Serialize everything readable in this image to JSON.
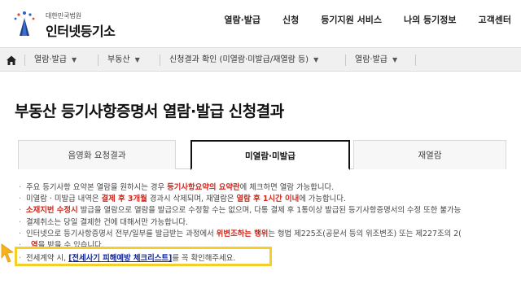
{
  "header": {
    "logo_sub": "대한민국법원",
    "logo_main": "인터넷등기소",
    "nav": [
      "열람·발급",
      "신청",
      "등기지원 서비스",
      "나의 등기정보",
      "고객센터"
    ]
  },
  "breadcrumb": {
    "items": [
      "열람·발급",
      "부동산",
      "신청결과 확인 (미열람·미발급/재열람 등)",
      "열람·발급"
    ]
  },
  "page": {
    "title": "부동산 등기사항증명서 열람·발급 신청결과"
  },
  "tabs": [
    {
      "label": "음영화 요청결과",
      "active": false
    },
    {
      "label": "미열람·미발급",
      "active": true
    },
    {
      "label": "재열람",
      "active": false
    }
  ],
  "notes": {
    "n1_a": "주요 등기사항 요약본 열람을 원하시는 경우 ",
    "n1_b": "등기사항요약의 요약란",
    "n1_c": "에 체크하면 열람 가능합니다.",
    "n2_a": "미열람 · 미발급 내역은 ",
    "n2_b": "결제 후 3개월",
    "n2_c": " 경과시 삭제되며, 재열람은 ",
    "n2_d": "열람 후 1시간 이내",
    "n2_e": "에 가능합니다.",
    "n3_a": "소재지번 수정시",
    "n3_b": " 발급을 열람으로 열람을 발급으로 수정할 수는 없으며, 다통 결제 후 1통이상 발급된 등기사항증명서의 수정 또한 불가능",
    "n4": "결제취소는 당일 결제한 건에 대해서만 가능합니다.",
    "n5_a": "인터넷으로 등기사항증명서 전부/일부를 발급받는 과정에서 ",
    "n5_b": "위변조하는 행위",
    "n5_c": "는 형법 제225조(공문서 등의 위조변조) 또는 제227조의 2(",
    "n5_d": "역",
    "n5_e": "을 받을 수 있습니다.",
    "n6_a": "전세계약 시, ",
    "n6_b": "[전세사기 피해예방 체크리스트]",
    "n6_c": "를 꼭 확인해주세요."
  },
  "colors": {
    "accent_red": "#d0281e",
    "link_blue": "#12269a",
    "highlight_yellow": "#f4cf2a",
    "pointer_orange": "#f5b21b"
  }
}
